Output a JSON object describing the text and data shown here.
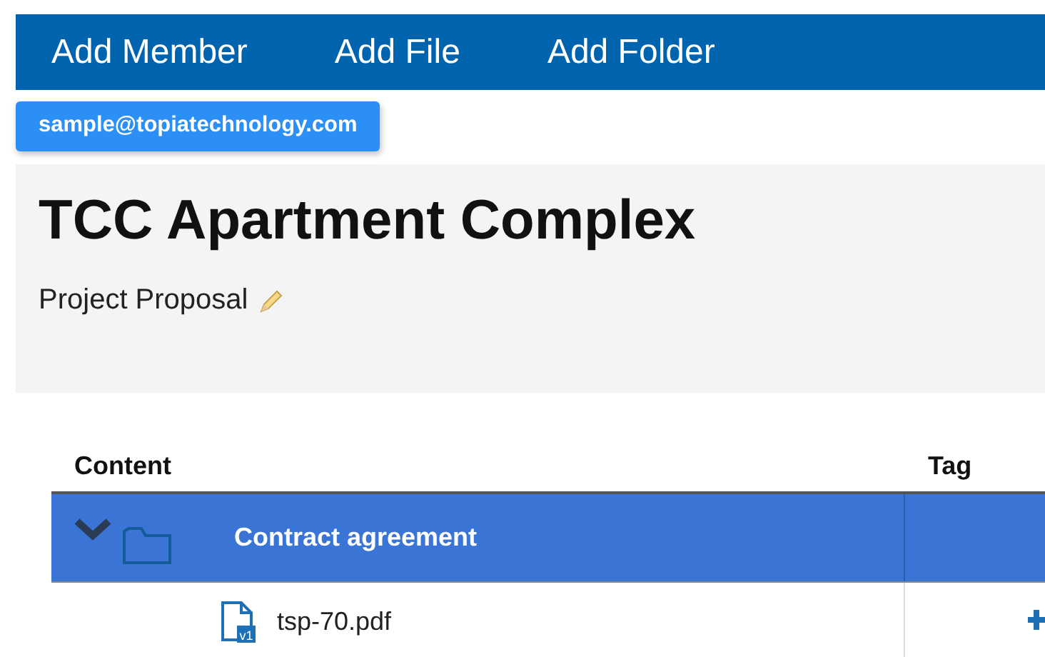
{
  "toolbar": {
    "buttons": [
      "Add Member",
      "Add File",
      "Add Folder"
    ]
  },
  "user_badge": "sample@topiatechnology.com",
  "project": {
    "title": "TCC Apartment Complex",
    "subtitle": "Project Proposal"
  },
  "table": {
    "columns": [
      "Content",
      "Tag"
    ],
    "rows": [
      {
        "kind": "folder",
        "name": "Contract agreement",
        "selected": true,
        "expanded": true,
        "children": [
          {
            "kind": "file",
            "name": "tsp-70.pdf",
            "version": "v1",
            "selected": false
          }
        ]
      }
    ]
  }
}
